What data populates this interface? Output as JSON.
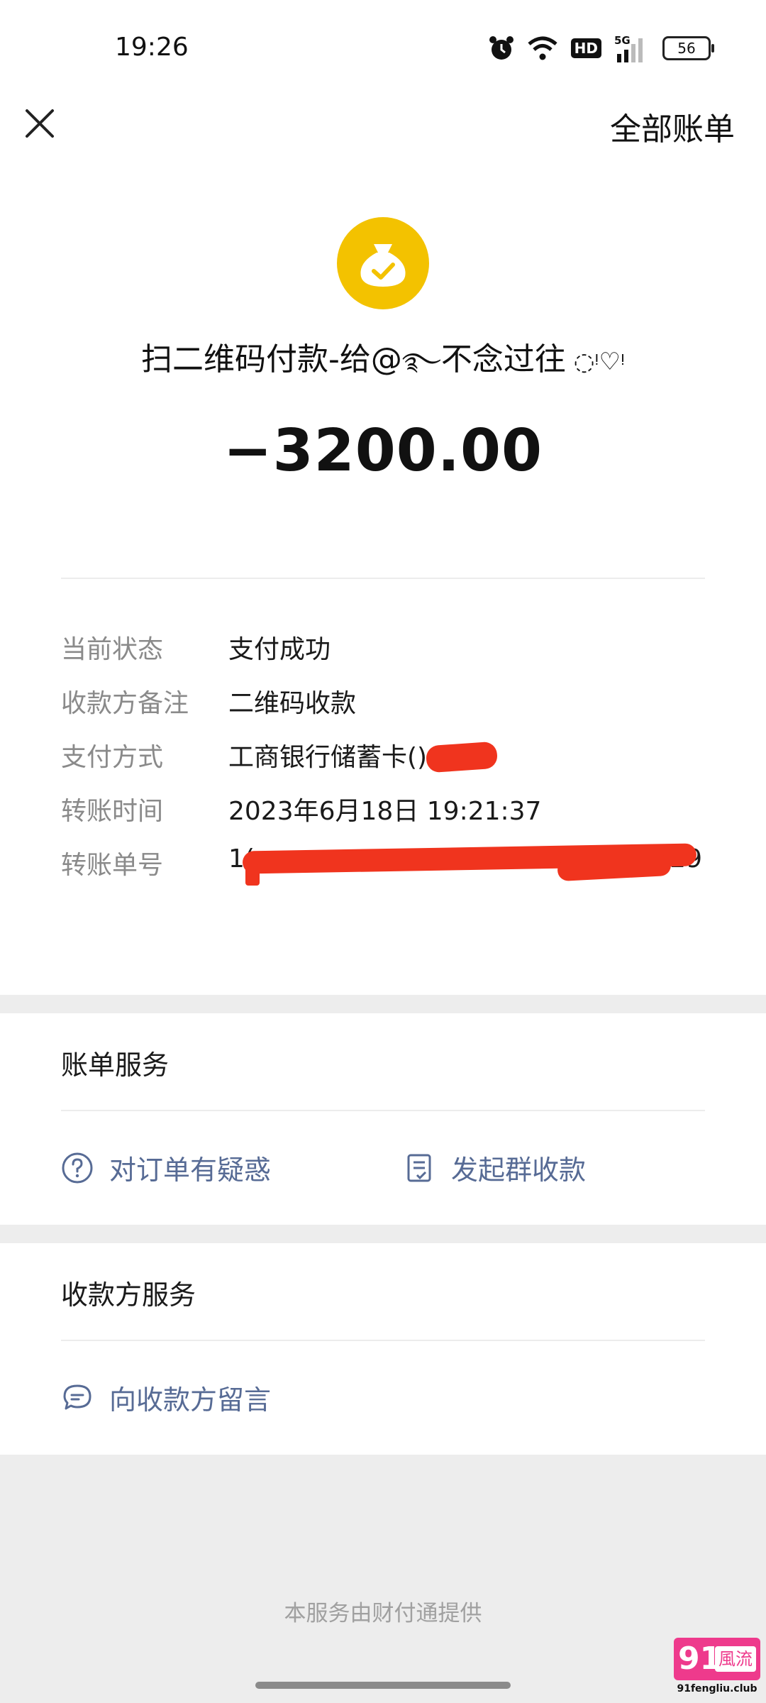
{
  "status_bar": {
    "time": "19:26",
    "network": "5G",
    "hd": "HD",
    "battery": "56"
  },
  "header": {
    "close_icon": "close-icon",
    "all_bills_label": "全部账单"
  },
  "transaction": {
    "icon": "money-bag-check-icon",
    "icon_color": "#f3c200",
    "title": "扫二维码付款-给@",
    "title_suffix": "不念过往",
    "amount": "−3200.00"
  },
  "details": [
    {
      "label": "当前状态",
      "value": "支付成功"
    },
    {
      "label": "收款方备注",
      "value": "二维码收款"
    },
    {
      "label": "支付方式",
      "value": "工商银行储蓄卡("
    },
    {
      "label": "转账时间",
      "value": "2023年6月18日 19:21:37"
    },
    {
      "label": "转账单号",
      "value_start": "1(",
      "value_end": "529"
    }
  ],
  "bill_service": {
    "title": "账单服务",
    "question_label": "对订单有疑惑",
    "group_collect_label": "发起群收款"
  },
  "payee_service": {
    "title": "收款方服务",
    "message_label": "向收款方留言"
  },
  "footer": {
    "provider_text": "本服务由财付通提供"
  },
  "watermark": {
    "number": "91",
    "cn": "風流",
    "url": "91fengliu.club"
  },
  "colors": {
    "link": "#576b95",
    "accent": "#f3c200",
    "redaction": "#f0341e",
    "watermark": "#ee3a8c"
  }
}
